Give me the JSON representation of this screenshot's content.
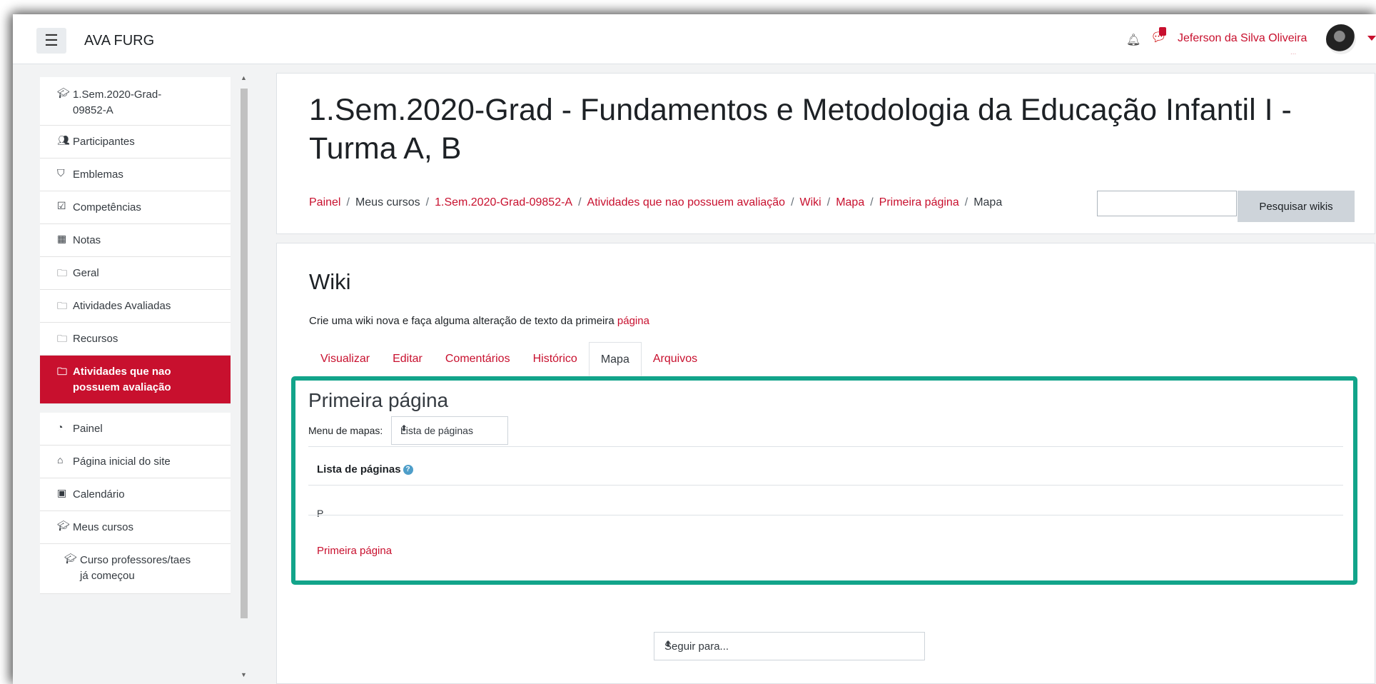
{
  "navbar": {
    "menu_icon": "hamburger-icon",
    "site_name": "AVA FURG",
    "user_name": "Jeferson da Silva Oliveira",
    "user_sub": "...",
    "notification_icon": "bell-icon",
    "message_icon": "chat-icon"
  },
  "sidebar": {
    "items": [
      {
        "label": "1.Sem.2020-Grad-09852-A",
        "icon": "graduation-cap-icon"
      },
      {
        "label": "Participantes",
        "icon": "users-icon"
      },
      {
        "label": "Emblemas",
        "icon": "shield-icon"
      },
      {
        "label": "Competências",
        "icon": "checkbox-icon"
      },
      {
        "label": "Notas",
        "icon": "table-icon"
      },
      {
        "label": "Geral",
        "icon": "folder-icon"
      },
      {
        "label": "Atividades Avaliadas",
        "icon": "folder-icon"
      },
      {
        "label": "Recursos",
        "icon": "folder-icon"
      },
      {
        "label": "Atividades que nao possuem avaliação",
        "icon": "folder-icon",
        "active": true
      },
      {
        "label": "Painel",
        "icon": "dashboard-icon"
      },
      {
        "label": "Página inicial do site",
        "icon": "home-icon"
      },
      {
        "label": "Calendário",
        "icon": "calendar-icon"
      },
      {
        "label": "Meus cursos",
        "icon": "graduation-cap-icon"
      },
      {
        "label": "Curso professores/taes já começou",
        "icon": "graduation-cap-icon"
      }
    ]
  },
  "header": {
    "title": "1.Sem.2020-Grad - Fundamentos e Metodologia da Educação Infantil I - Turma A, B",
    "breadcrumb": [
      {
        "label": "Painel",
        "link": true
      },
      {
        "label": "Meus cursos",
        "link": false
      },
      {
        "label": "1.Sem.2020-Grad-09852-A",
        "link": true
      },
      {
        "label": "Atividades que nao possuem avaliação",
        "link": true
      },
      {
        "label": "Wiki",
        "link": true
      },
      {
        "label": "Mapa",
        "link": true
      },
      {
        "label": "Primeira página",
        "link": true
      },
      {
        "label": "Mapa",
        "link": false
      }
    ],
    "search_value": "",
    "search_button": "Pesquisar wikis"
  },
  "main": {
    "wiki_title": "Wiki",
    "intro_text": "Crie uma wiki nova e faça alguma alteração de texto da primeira ",
    "intro_link": "página",
    "tabs": [
      {
        "label": "Visualizar",
        "active": false
      },
      {
        "label": "Editar",
        "active": false
      },
      {
        "label": "Comentários",
        "active": false
      },
      {
        "label": "Histórico",
        "active": false
      },
      {
        "label": "Mapa",
        "active": true
      },
      {
        "label": "Arquivos",
        "active": false
      }
    ],
    "page_heading": "Primeira página",
    "map_menu_label": "Menu de mapas:",
    "map_menu_selected": "Lista de páginas",
    "list_heading": "Lista de páginas",
    "help_icon": "question-circle-icon",
    "letter": "P",
    "page_link": "Primeira página",
    "jump_select": "Seguir para..."
  },
  "colors": {
    "brand": "#c8102e",
    "highlight": "#12a48a"
  }
}
